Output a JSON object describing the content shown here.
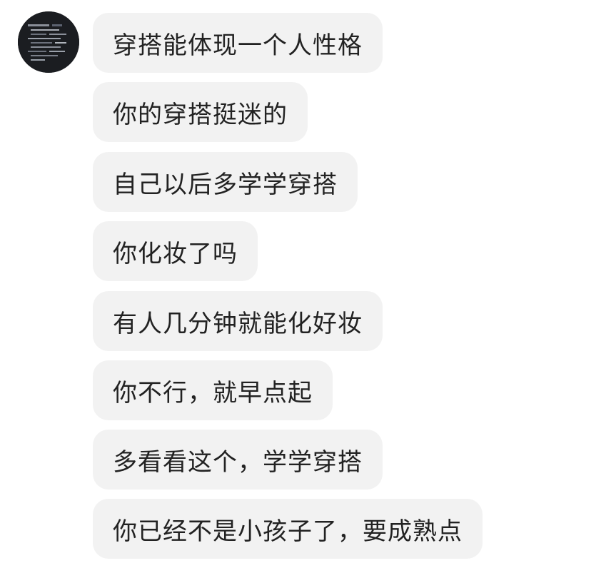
{
  "chat": {
    "avatar_icon": "code-screen-avatar",
    "messages": [
      {
        "text": "穿搭能体现一个人性格"
      },
      {
        "text": "你的穿搭挺迷的"
      },
      {
        "text": "自己以后多学学穿搭"
      },
      {
        "text": "你化妆了吗"
      },
      {
        "text": "有人几分钟就能化好妆"
      },
      {
        "text": "你不行，就早点起"
      },
      {
        "text": "多看看这个，学学穿搭"
      },
      {
        "text": "你已经不是小孩子了，要成熟点"
      }
    ]
  },
  "colors": {
    "bubble_bg": "#f2f2f2",
    "text": "#222222",
    "avatar_bg": "#1b1d21"
  }
}
